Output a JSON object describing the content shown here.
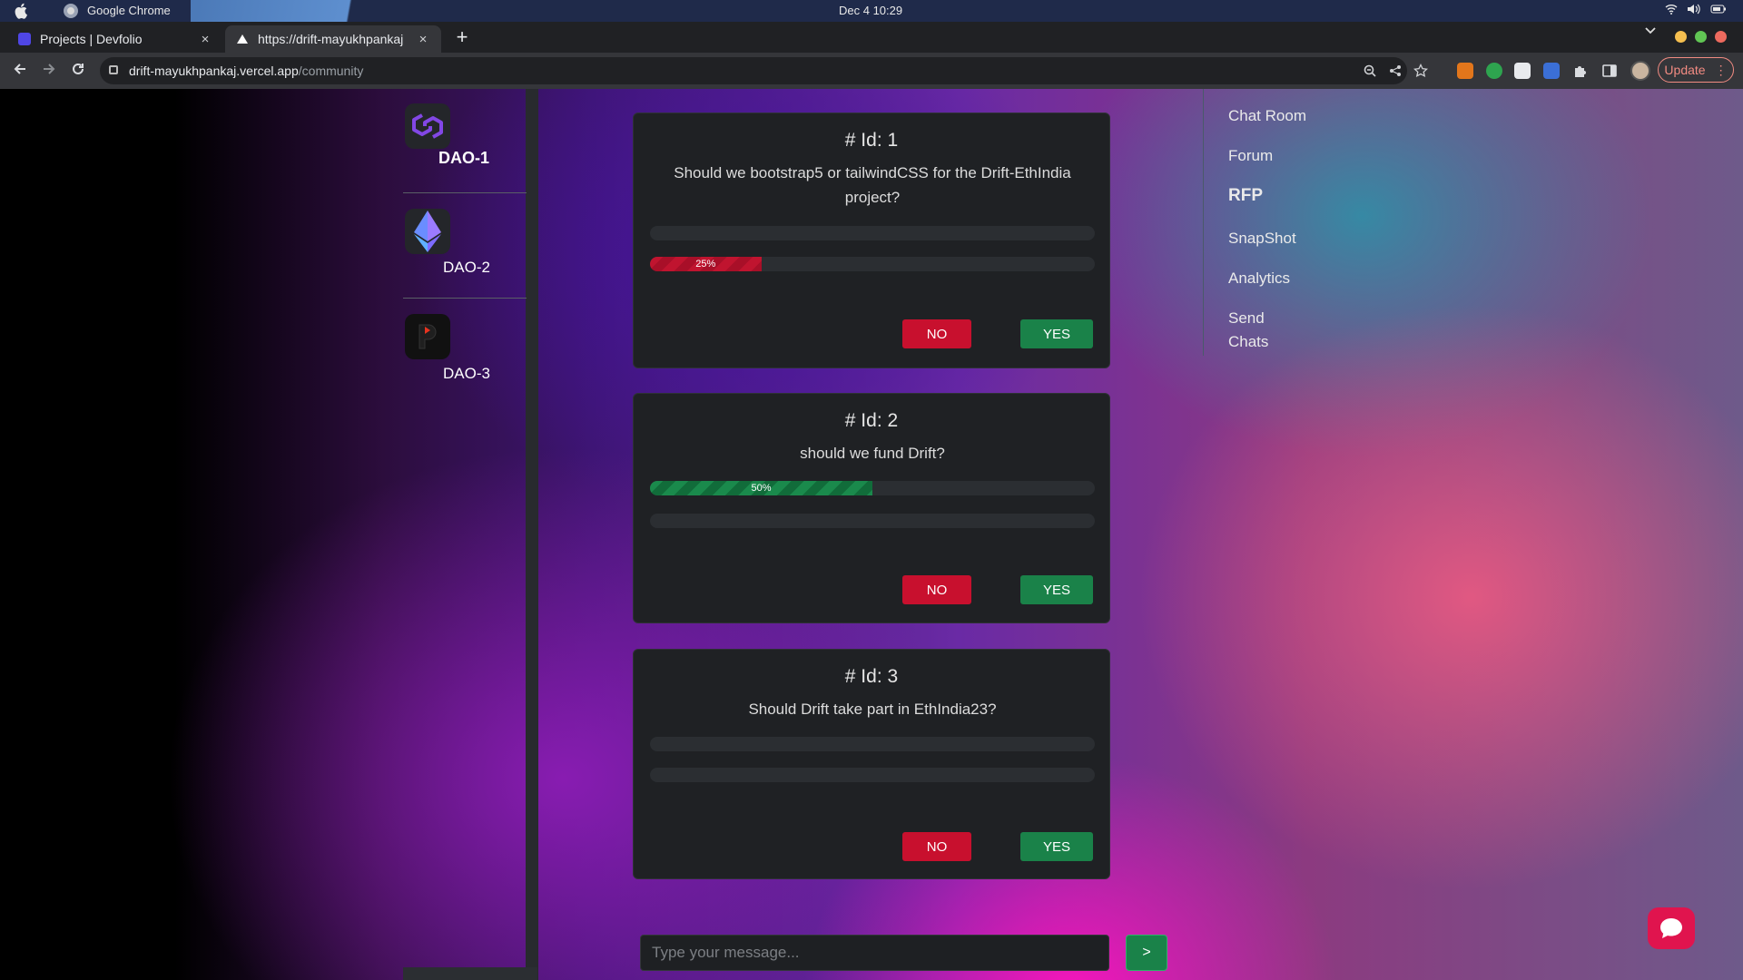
{
  "menubar": {
    "app_name": "Google Chrome",
    "clock": "Dec 4  10:29"
  },
  "tabs": [
    {
      "title": "Projects | Devfolio",
      "close": "×",
      "favicon_color": "#4f46e5"
    },
    {
      "title": "https://drift-mayukhpankaj",
      "close": "×",
      "favicon_color": "#ffffff"
    }
  ],
  "new_tab": "+",
  "toolbar": {
    "url_host": "drift-mayukhpankaj.vercel.app",
    "url_path": "/community",
    "update_label": "Update",
    "menu_dots": "⋮"
  },
  "sidebar": {
    "daos": [
      {
        "label": "DAO-1",
        "accent": "#8247e5"
      },
      {
        "label": "DAO-2",
        "accent": "#5298ff"
      },
      {
        "label": "DAO-3",
        "accent": "#e8331f"
      }
    ]
  },
  "proposals": [
    {
      "id_label": "# Id: 1",
      "question": "Should we bootstrap5 or tailwindCSS for the Drift-EthIndia project?",
      "yes_percent": 0,
      "yes_label": "",
      "no_percent": 25,
      "no_label": "25%",
      "no_button": "NO",
      "yes_button": "YES"
    },
    {
      "id_label": "# Id: 2",
      "question": "should we fund Drift?",
      "yes_percent": 50,
      "yes_label": "50%",
      "no_percent": 0,
      "no_label": "",
      "no_button": "NO",
      "yes_button": "YES"
    },
    {
      "id_label": "# Id: 3",
      "question": "Should Drift take part in EthIndia23?",
      "yes_percent": 0,
      "yes_label": "",
      "no_percent": 0,
      "no_label": "",
      "no_button": "NO",
      "yes_button": "YES"
    }
  ],
  "right_nav": {
    "items": [
      "Chat Room",
      "Forum",
      "RFP",
      "SnapShot",
      "Analytics",
      "Send Chats"
    ],
    "active": "RFP"
  },
  "chat": {
    "placeholder": "Type your message...",
    "send_label": ">"
  },
  "colors": {
    "no_red": "#c8102e",
    "yes_green": "#1a8249",
    "card_bg": "#1f2124",
    "fab": "#e0144e"
  }
}
